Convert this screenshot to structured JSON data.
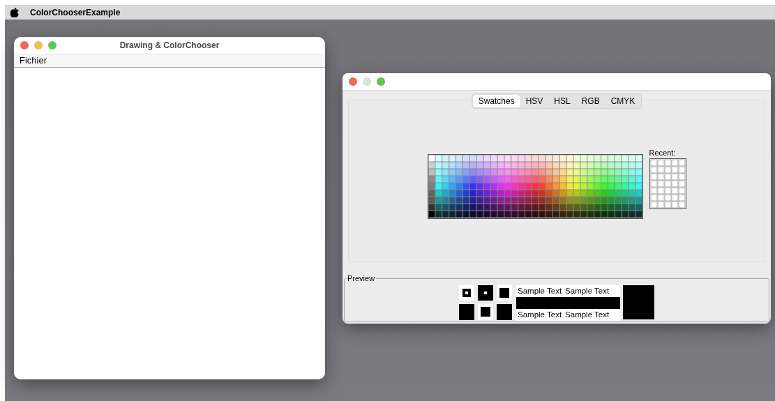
{
  "menubar": {
    "app_name": "ColorChooserExample"
  },
  "drawing_window": {
    "title": "Drawing & ColorChooser",
    "minimize_enabled": true,
    "menu": [
      {
        "label": "Fichier"
      }
    ]
  },
  "chooser_window": {
    "minimize_enabled": false,
    "tabs": [
      {
        "label": "Swatches",
        "selected": true
      },
      {
        "label": "HSV",
        "selected": false
      },
      {
        "label": "HSL",
        "selected": false
      },
      {
        "label": "RGB",
        "selected": false
      },
      {
        "label": "CMYK",
        "selected": false
      }
    ],
    "recent_label": "Recent:",
    "preview": {
      "label": "Preview",
      "top_texts": [
        "Sample Text",
        "Sample Text"
      ],
      "bottom_texts": [
        "Sample Text",
        "Sample Text"
      ]
    }
  }
}
